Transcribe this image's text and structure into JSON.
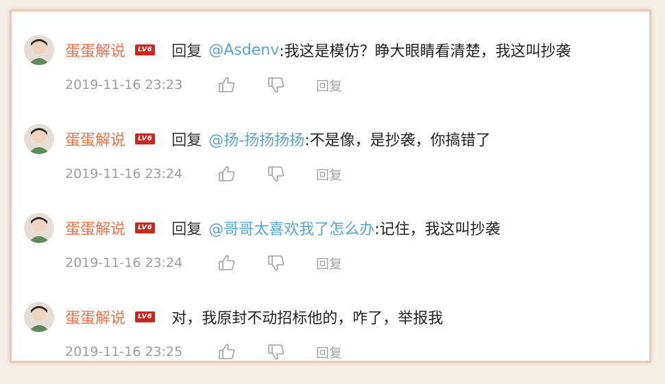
{
  "comments": [
    {
      "username": "蛋蛋解说",
      "badge": "LV6",
      "reply_label": "回复",
      "mention": "@Asdenv",
      "text": ":我这是模仿？睁大眼睛看清楚，我这叫抄袭",
      "time": "2019-11-16 23:23",
      "reply_button": "回复"
    },
    {
      "username": "蛋蛋解说",
      "badge": "LV6",
      "reply_label": "回复",
      "mention": "@扬-扬扬扬扬",
      "text": ":不是像，是抄袭，你搞错了",
      "time": "2019-11-16 23:24",
      "reply_button": "回复"
    },
    {
      "username": "蛋蛋解说",
      "badge": "LV6",
      "reply_label": "回复",
      "mention": "@哥哥太喜欢我了怎么办",
      "text": ":记住，我这叫抄袭",
      "time": "2019-11-16 23:24",
      "reply_button": "回复"
    },
    {
      "username": "蛋蛋解说",
      "badge": "LV6",
      "text": "对，我原封不动招标他的，咋了，举报我",
      "time": "2019-11-16 23:25",
      "reply_button": "回复"
    }
  ],
  "icons": {
    "like": "thumbs-up-icon",
    "dislike": "thumbs-down-icon"
  },
  "colors": {
    "username": "#eb7350",
    "mention": "#5ba4cf",
    "badge": "#c9261e",
    "meta": "#9c9c9c"
  }
}
